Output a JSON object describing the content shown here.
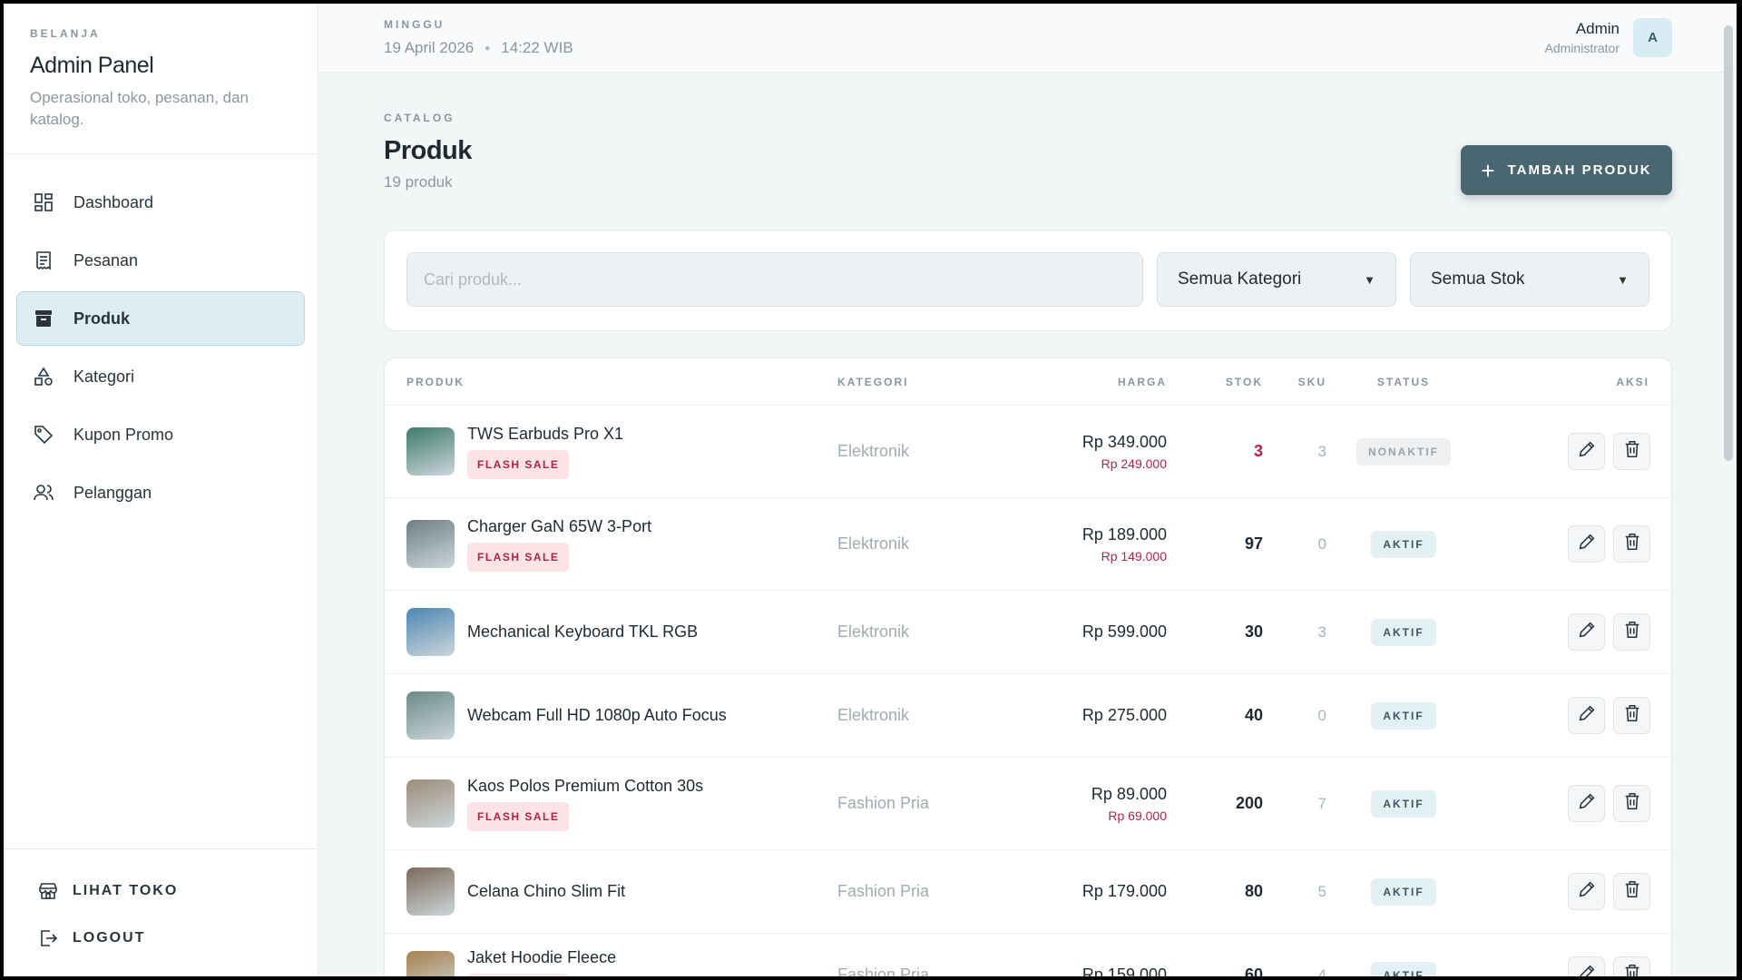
{
  "sidebar": {
    "kicker": "BELANJA",
    "title": "Admin Panel",
    "subtitle": "Operasional toko, pesanan, dan katalog.",
    "items": [
      {
        "label": "Dashboard",
        "icon": "dashboard-icon"
      },
      {
        "label": "Pesanan",
        "icon": "receipt-icon"
      },
      {
        "label": "Produk",
        "icon": "archive-icon",
        "active": true
      },
      {
        "label": "Kategori",
        "icon": "shapes-icon"
      },
      {
        "label": "Kupon Promo",
        "icon": "tag-icon"
      },
      {
        "label": "Pelanggan",
        "icon": "users-icon"
      }
    ],
    "bottom": [
      {
        "label": "LIHAT TOKO",
        "icon": "store-icon"
      },
      {
        "label": "LOGOUT",
        "icon": "logout-icon"
      }
    ]
  },
  "topbar": {
    "day": "MINGGU",
    "date": "19 April 2026",
    "time": "14:22 WIB",
    "user_name": "Admin",
    "user_role": "Administrator",
    "avatar_letter": "A"
  },
  "page": {
    "kicker": "CATALOG",
    "title": "Produk",
    "count": "19 produk",
    "add_button": "TAMBAH PRODUK"
  },
  "filters": {
    "search_placeholder": "Cari produk...",
    "category": "Semua Kategori",
    "stock": "Semua Stok"
  },
  "table": {
    "headers": {
      "product": "PRODUK",
      "category": "KATEGORI",
      "price": "HARGA",
      "stock": "STOK",
      "sku": "SKU",
      "status": "STATUS",
      "action": "AKSI"
    },
    "rows": [
      {
        "name": "TWS Earbuds Pro X1",
        "flash": "FLASH SALE",
        "category": "Elektronik",
        "price": "Rp 349.000",
        "promo": "Rp 249.000",
        "stock": "3",
        "low": true,
        "sku": "3",
        "status": "NONAKTIF",
        "active": false,
        "thumb": "#3e7a6a"
      },
      {
        "name": "Charger GaN 65W 3-Port",
        "flash": "FLASH SALE",
        "category": "Elektronik",
        "price": "Rp 189.000",
        "promo": "Rp 149.000",
        "stock": "97",
        "sku": "0",
        "status": "AKTIF",
        "active": true,
        "thumb": "#6d7f86"
      },
      {
        "name": "Mechanical Keyboard TKL RGB",
        "category": "Elektronik",
        "price": "Rp 599.000",
        "stock": "30",
        "sku": "3",
        "status": "AKTIF",
        "active": true,
        "thumb": "#4d86b3"
      },
      {
        "name": "Webcam Full HD 1080p Auto Focus",
        "category": "Elektronik",
        "price": "Rp 275.000",
        "stock": "40",
        "sku": "0",
        "status": "AKTIF",
        "active": true,
        "thumb": "#6a8a86"
      },
      {
        "name": "Kaos Polos Premium Cotton 30s",
        "flash": "FLASH SALE",
        "category": "Fashion Pria",
        "price": "Rp 89.000",
        "promo": "Rp 69.000",
        "stock": "200",
        "sku": "7",
        "status": "AKTIF",
        "active": true,
        "thumb": "#9c8c78"
      },
      {
        "name": "Celana Chino Slim Fit",
        "category": "Fashion Pria",
        "price": "Rp 179.000",
        "stock": "80",
        "sku": "5",
        "status": "AKTIF",
        "active": true,
        "thumb": "#7d6a5a"
      },
      {
        "name": "Jaket Hoodie Fleece",
        "flash": "FLASH SALE",
        "category": "Fashion Pria",
        "price": "Rp 159.000",
        "stock": "60",
        "sku": "4",
        "status": "AKTIF",
        "active": true,
        "thumb": "#a8814f"
      }
    ]
  }
}
